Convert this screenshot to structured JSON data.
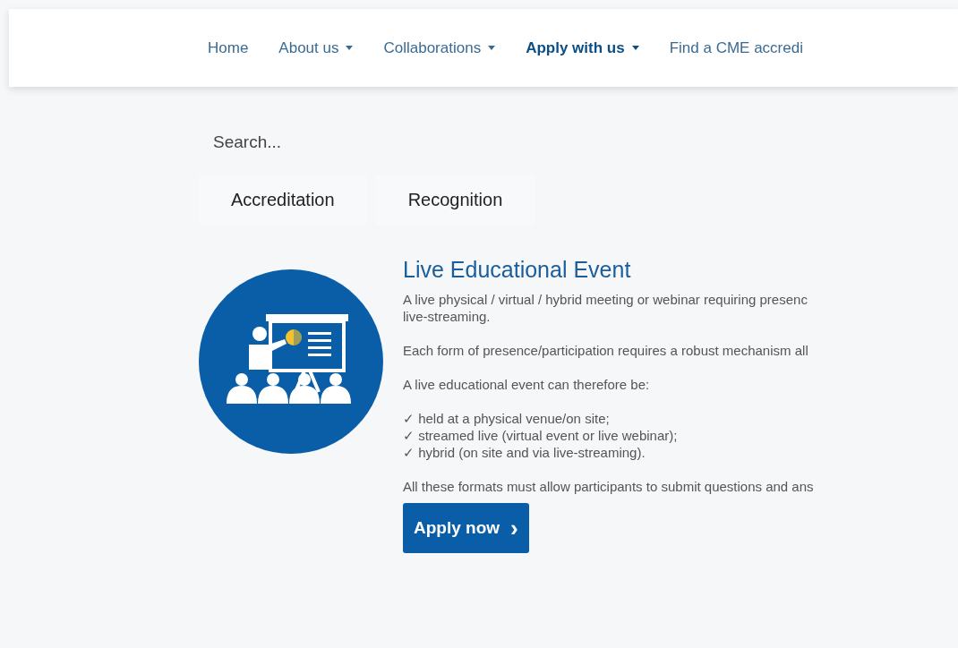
{
  "nav": {
    "items": [
      {
        "label": "Home",
        "selected": false,
        "dropdown": false
      },
      {
        "label": "About us",
        "selected": false,
        "dropdown": true
      },
      {
        "label": "Collaborations",
        "selected": false,
        "dropdown": true
      },
      {
        "label": "Apply with us",
        "selected": true,
        "dropdown": true
      },
      {
        "label": "Find a CME accredi",
        "selected": false,
        "dropdown": false
      }
    ]
  },
  "search": {
    "placeholder": "Search..."
  },
  "tabs": [
    {
      "label": "Accreditation"
    },
    {
      "label": "Recognition"
    }
  ],
  "card": {
    "title": "Live Educational Event",
    "paragraphs": [
      [
        "A live physical / virtual / hybrid meeting or webinar requiring presenc",
        "live-streaming."
      ],
      [
        "Each form of presence/participation requires a robust mechanism all"
      ],
      [
        "A live educational event can therefore be:"
      ],
      [
        "✓ held at a physical venue/on site;",
        "✓ streamed live (virtual event or live webinar);",
        "✓ hybrid (on site and via live-streaming)."
      ],
      [
        "All these formats must allow participants to submit questions and ans"
      ]
    ],
    "button": {
      "label": "Apply now",
      "icon": "›"
    }
  }
}
